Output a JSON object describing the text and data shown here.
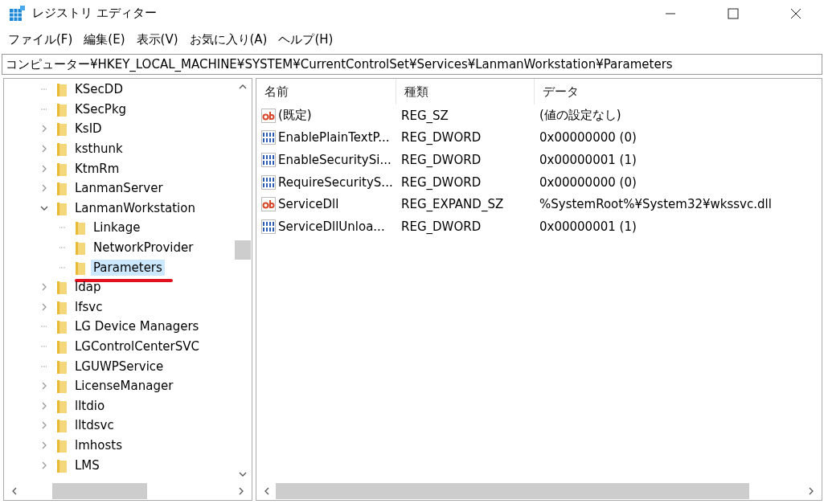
{
  "window": {
    "title": "レジストリ エディター"
  },
  "menu": [
    "ファイル(F)",
    "編集(E)",
    "表示(V)",
    "お気に入り(A)",
    "ヘルプ(H)"
  ],
  "address": "コンピューター¥HKEY_LOCAL_MACHINE¥SYSTEM¥CurrentControlSet¥Services¥LanmanWorkstation¥Parameters",
  "tree": [
    {
      "label": "KSecDD",
      "expandable": false,
      "selected": false
    },
    {
      "label": "KSecPkg",
      "expandable": false,
      "selected": false
    },
    {
      "label": "KsID",
      "expandable": true,
      "expanded": false,
      "selected": false
    },
    {
      "label": "ksthunk",
      "expandable": true,
      "expanded": false,
      "selected": false
    },
    {
      "label": "KtmRm",
      "expandable": true,
      "expanded": false,
      "selected": false
    },
    {
      "label": "LanmanServer",
      "expandable": true,
      "expanded": false,
      "selected": false
    },
    {
      "label": "LanmanWorkstation",
      "expandable": true,
      "expanded": true,
      "selected": false,
      "children": [
        {
          "label": "Linkage",
          "expandable": false,
          "selected": false
        },
        {
          "label": "NetworkProvider",
          "expandable": false,
          "selected": false
        },
        {
          "label": "Parameters",
          "expandable": false,
          "selected": true,
          "underlined": true
        }
      ]
    },
    {
      "label": "ldap",
      "expandable": true,
      "expanded": false,
      "selected": false
    },
    {
      "label": "lfsvc",
      "expandable": true,
      "expanded": false,
      "selected": false
    },
    {
      "label": "LG Device Managers",
      "expandable": false,
      "selected": false
    },
    {
      "label": "LGControlCenterSVC",
      "expandable": false,
      "selected": false
    },
    {
      "label": "LGUWPService",
      "expandable": false,
      "selected": false
    },
    {
      "label": "LicenseManager",
      "expandable": true,
      "expanded": false,
      "selected": false
    },
    {
      "label": "lltdio",
      "expandable": true,
      "expanded": false,
      "selected": false
    },
    {
      "label": "lltdsvc",
      "expandable": true,
      "expanded": false,
      "selected": false
    },
    {
      "label": "lmhosts",
      "expandable": true,
      "expanded": false,
      "selected": false
    },
    {
      "label": "LMS",
      "expandable": true,
      "expanded": false,
      "selected": false
    }
  ],
  "table": {
    "columns": [
      "名前",
      "種類",
      "データ"
    ],
    "rows": [
      {
        "kind": "string",
        "name": "(既定)",
        "type": "REG_SZ",
        "data": "(値の設定なし)"
      },
      {
        "kind": "binary",
        "name": "EnablePlainTextP...",
        "type": "REG_DWORD",
        "data": "0x00000000 (0)"
      },
      {
        "kind": "binary",
        "name": "EnableSecuritySi...",
        "type": "REG_DWORD",
        "data": "0x00000001 (1)"
      },
      {
        "kind": "binary",
        "name": "RequireSecurityS...",
        "type": "REG_DWORD",
        "data": "0x00000000 (0)"
      },
      {
        "kind": "string",
        "name": "ServiceDll",
        "type": "REG_EXPAND_SZ",
        "data": "%SystemRoot%¥System32¥wkssvc.dll"
      },
      {
        "kind": "binary",
        "name": "ServiceDllUnloa...",
        "type": "REG_DWORD",
        "data": "0x00000001 (1)"
      }
    ]
  }
}
